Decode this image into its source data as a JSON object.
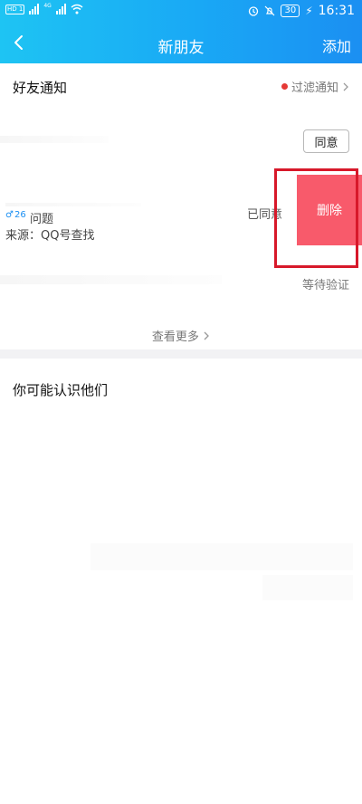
{
  "status": {
    "hd1": "HD 1",
    "hd2": "HD 2",
    "net1": "4G",
    "net2": "4G",
    "battery": "30",
    "time": "16:31"
  },
  "header": {
    "title": "新朋友",
    "add_label": "添加"
  },
  "notices": {
    "title": "好友通知",
    "filter_label": "过滤通知",
    "agree_label": "同意",
    "item": {
      "age": "26",
      "question": "问题",
      "source": "来源：QQ号查找",
      "agreed_label": "已同意",
      "delete_label": "删除"
    },
    "waiting_label": "等待验证",
    "more_label": "查看更多"
  },
  "maybe_know": {
    "title": "你可能认识他们"
  },
  "colors": {
    "header_start": "#1ec4f3",
    "header_end": "#1b8ff2",
    "delete_bg": "#f85a6b",
    "highlight": "#d7182a"
  },
  "icons": {
    "back": "chevron-left-icon",
    "filter_arrow": "chevron-right-icon",
    "more_arrow": "chevron-right-icon",
    "gender": "male-icon"
  }
}
